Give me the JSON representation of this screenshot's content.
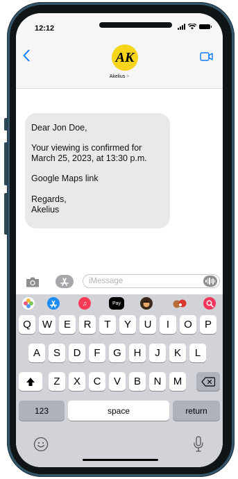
{
  "status": {
    "time": "12:12"
  },
  "header": {
    "avatar_text": "AK",
    "contact_name": "Akelius",
    "contact_chevron": ">"
  },
  "message": {
    "lines": [
      "Dear Jon Doe,",
      "Your viewing is confirmed for",
      "March 25, 2023, at 13:30 p.m.",
      "Google Maps link",
      "Regards,",
      "Akelius"
    ]
  },
  "input": {
    "placeholder": "iMessage"
  },
  "keyboard": {
    "row1": [
      "Q",
      "W",
      "E",
      "R",
      "T",
      "Y",
      "U",
      "I",
      "O",
      "P"
    ],
    "row2": [
      "A",
      "S",
      "D",
      "F",
      "G",
      "H",
      "J",
      "K",
      "L"
    ],
    "row3": [
      "Z",
      "X",
      "C",
      "V",
      "B",
      "N",
      "M"
    ],
    "numbers_label": "123",
    "space_label": "space",
    "return_label": "return",
    "apple_pay_label": "Pay"
  },
  "colors": {
    "accent": "#0a7aff",
    "avatar": "#f7d51a",
    "frame": "#34556a",
    "bubble": "#e9e9eb",
    "keyboard": "#d1d3d9"
  },
  "icons": [
    "back-chevron-icon",
    "video-call-icon",
    "camera-icon",
    "app-store-icon",
    "audio-message-icon",
    "photos-icon",
    "music-icon",
    "memoji-icon",
    "search-icon",
    "shift-icon",
    "delete-icon",
    "emoji-icon",
    "microphone-icon",
    "signal-icon",
    "wifi-icon",
    "battery-icon"
  ]
}
